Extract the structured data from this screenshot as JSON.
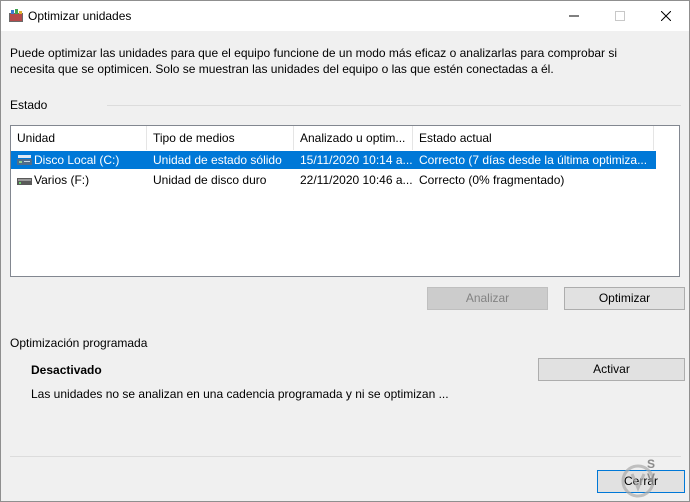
{
  "window": {
    "title": "Optimizar unidades",
    "description": "Puede optimizar las unidades para que el equipo funcione de un modo más eficaz o analizarlas para comprobar si necesita que se optimicen. Solo se muestran las unidades del equipo o las que estén conectadas a él."
  },
  "estado": {
    "label": "Estado",
    "columns": [
      "Unidad",
      "Tipo de medios",
      "Analizado u optim...",
      "Estado actual"
    ],
    "rows": [
      {
        "unidad": "Disco Local (C:)",
        "tipo": "Unidad de estado sólido",
        "analizado": "15/11/2020 10:14 a...",
        "estado": "Correcto (7 días desde la última optimiza...",
        "selected": true,
        "icon": "ssd-drive-icon"
      },
      {
        "unidad": "Varios (F:)",
        "tipo": "Unidad de disco duro",
        "analizado": "22/11/2020 10:46 a...",
        "estado": "Correcto (0% fragmentado)",
        "selected": false,
        "icon": "hard-drive-icon"
      }
    ]
  },
  "buttons": {
    "analizar": "Analizar",
    "optimizar": "Optimizar",
    "activar": "Activar",
    "cerrar": "Cerrar"
  },
  "programada": {
    "label": "Optimización programada",
    "status": "Desactivado",
    "description": "Las unidades no se analizan en una cadencia programada y ni se optimizan ..."
  },
  "watermark": {
    "line1": "S",
    "line2": "V"
  },
  "colors": {
    "selection": "#0078d7",
    "window_bg": "#f0f0f0",
    "disabled_btn": "#cccccc"
  }
}
